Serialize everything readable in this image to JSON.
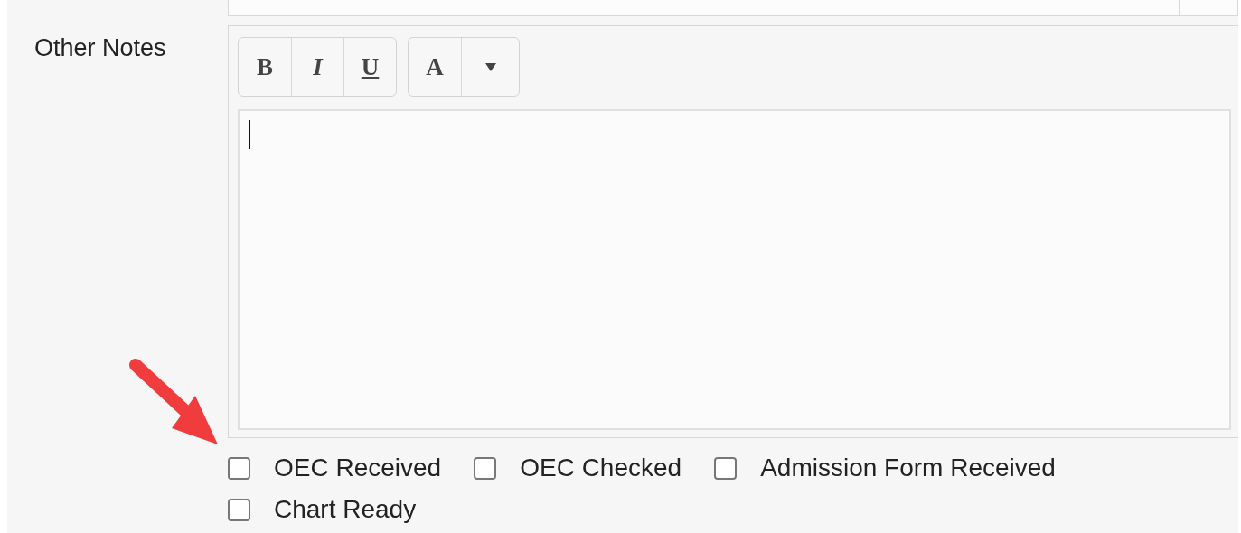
{
  "label": "Other Notes",
  "toolbar": [
    {
      "kind": "bold",
      "text": "B"
    },
    {
      "kind": "italic",
      "text": "I"
    },
    {
      "kind": "underline",
      "text": "U"
    }
  ],
  "color_button": {
    "text": "A"
  },
  "checkboxes": [
    {
      "label": "OEC Received",
      "checked": false
    },
    {
      "label": "OEC Checked",
      "checked": false
    },
    {
      "label": "Admission Form Received",
      "checked": false
    },
    {
      "label": "Chart Ready",
      "checked": false
    }
  ]
}
